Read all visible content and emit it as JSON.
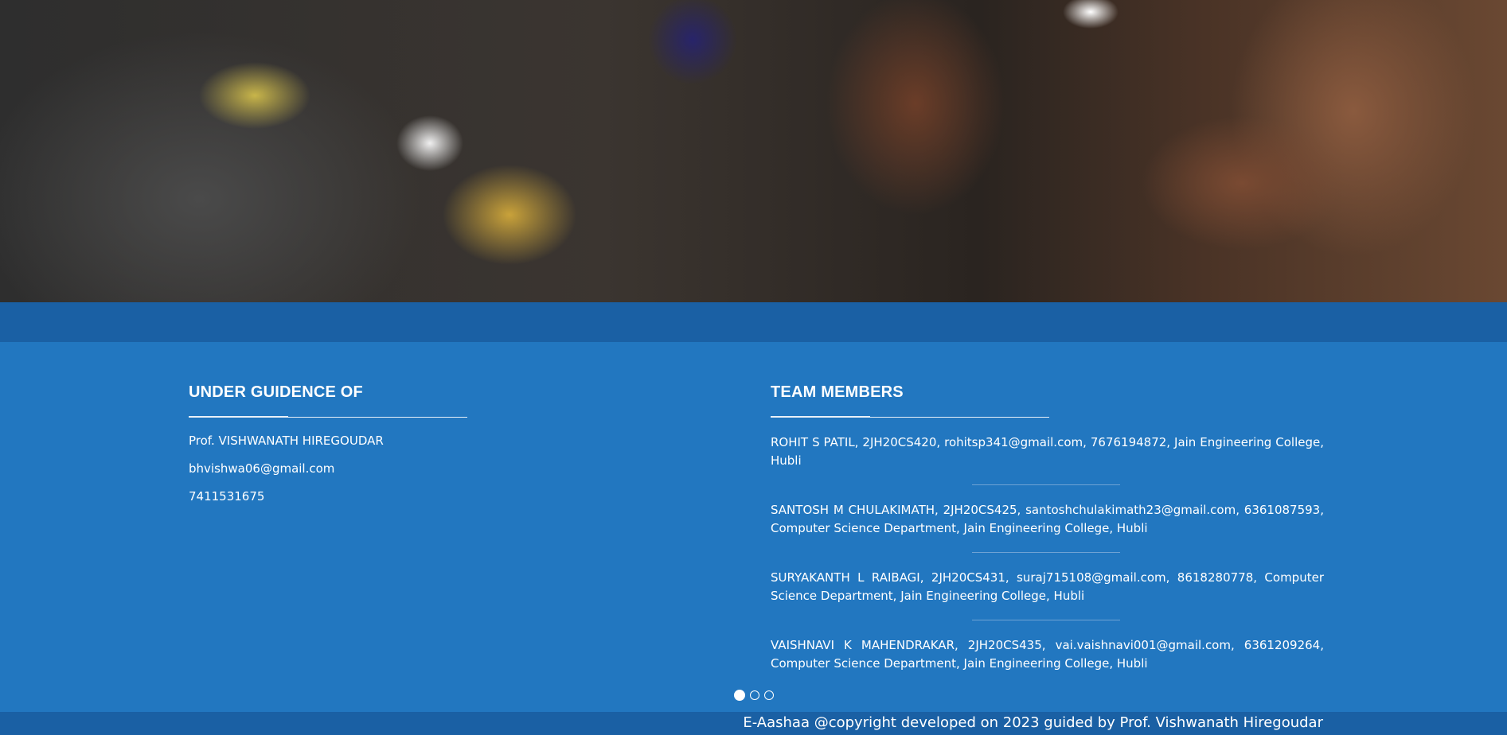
{
  "guidance": {
    "title": "UNDER GUIDENCE OF",
    "name": "Prof. VISHWANATH HIREGOUDAR",
    "email": "bhvishwa06@gmail.com",
    "phone": "7411531675"
  },
  "team": {
    "title": "TEAM MEMBERS",
    "members": [
      "ROHIT S PATIL, 2JH20CS420, rohitsp341@gmail.com, 7676194872, Jain Engineering College, Hubli",
      "SANTOSH M CHULAKIMATH, 2JH20CS425, santoshchulakimath23@gmail.com, 6361087593, Computer Science Department, Jain Engineering College, Hubli",
      "SURYAKANTH L RAIBAGI, 2JH20CS431, suraj715108@gmail.com, 8618280778, Computer Science Department, Jain Engineering College, Hubli",
      "VAISHNAVI K MAHENDRAKAR, 2JH20CS435, vai.vaishnavi001@gmail.com, 6361209264, Computer Science Department, Jain Engineering College, Hubli"
    ]
  },
  "carousel": {
    "dot_count": 3,
    "active_index": 0
  },
  "copyright": "E-Aashaa @copyright developed on 2023 guided by Prof. Vishwanath Hiregoudar",
  "colors": {
    "footer_bg": "#2277c0",
    "band_bg": "#1a60a4",
    "text": "#ffffff"
  }
}
